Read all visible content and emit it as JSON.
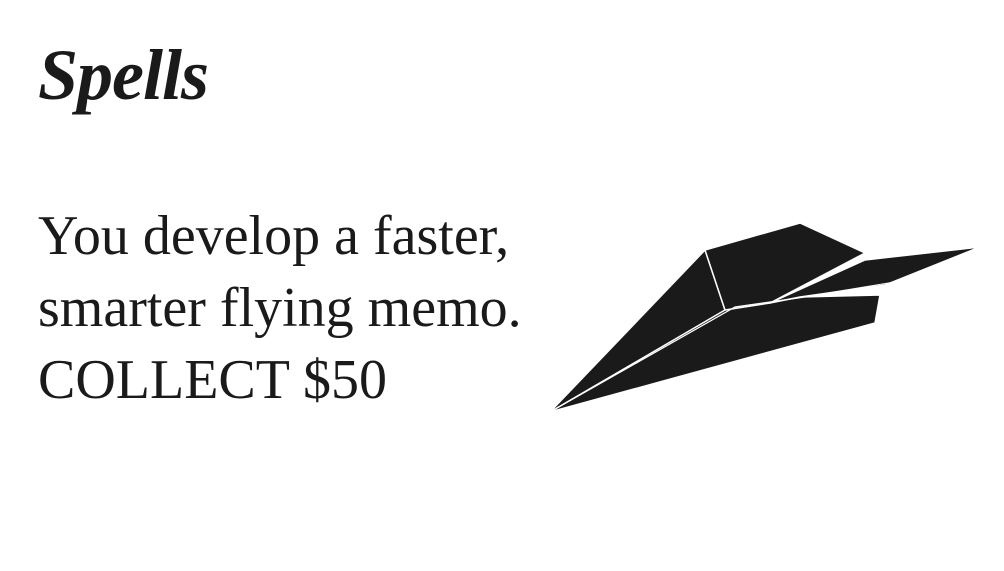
{
  "card": {
    "title": "Spells",
    "lines": [
      "You develop a faster,",
      "smarter flying memo.",
      "COLLECT $50"
    ],
    "illustration": "paper-airplane-icon",
    "colors": {
      "ink": "#1a1a1a",
      "background": "#ffffff"
    }
  }
}
